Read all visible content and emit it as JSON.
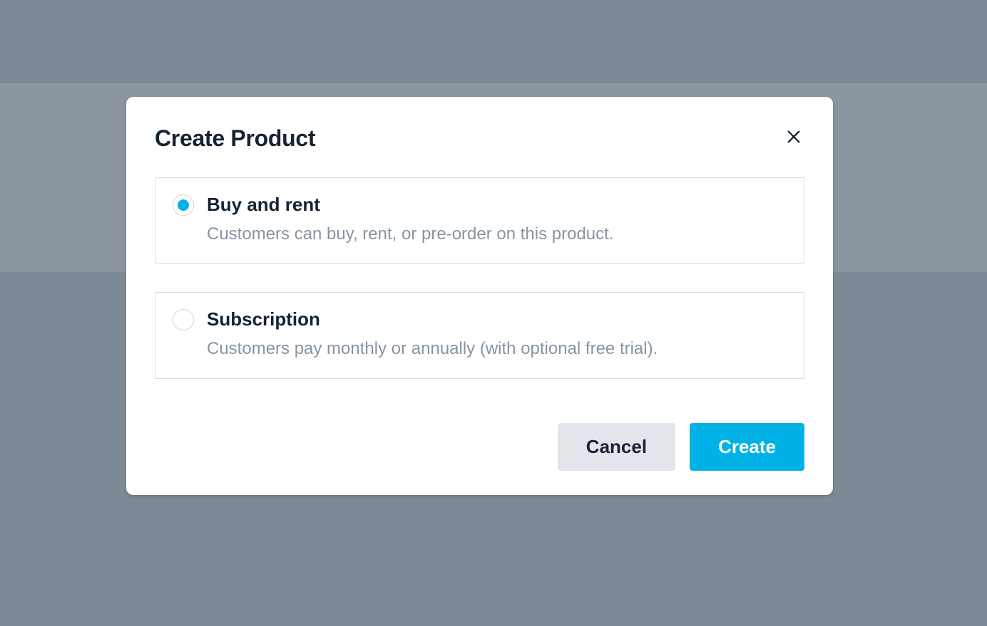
{
  "modal": {
    "title": "Create Product",
    "options": [
      {
        "title": "Buy and rent",
        "description": "Customers can buy, rent, or pre-order on this product.",
        "selected": true
      },
      {
        "title": "Subscription",
        "description": "Customers pay monthly or annually (with optional free trial).",
        "selected": false
      }
    ],
    "buttons": {
      "cancel": "Cancel",
      "create": "Create"
    }
  },
  "colors": {
    "accent": "#00b2e6",
    "text_primary": "#162332",
    "text_secondary": "#8794a2"
  }
}
